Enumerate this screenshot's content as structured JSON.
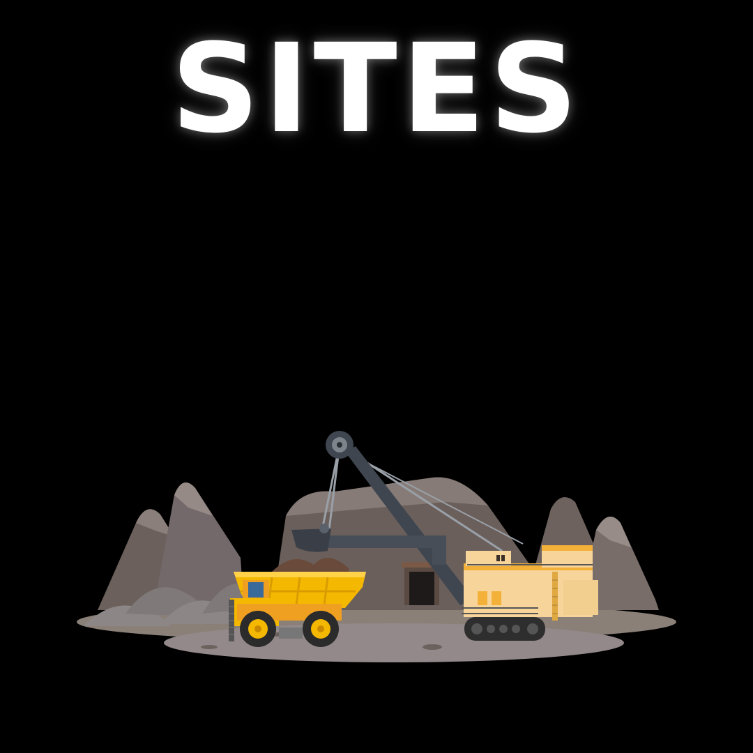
{
  "title": "SITES",
  "colors": {
    "background": "#000000",
    "title": "#ffffff",
    "truck_yellow": "#f5b800",
    "truck_orange": "#f0a020",
    "excavator_body": "#f7d49a",
    "excavator_accent": "#f3b13a",
    "boom": "#3f4650",
    "mountain": "#6f6460",
    "ground": "#8a8078"
  },
  "icons": [
    "mountain-icon",
    "dump-truck-icon",
    "excavator-icon",
    "mine-entrance-icon"
  ]
}
